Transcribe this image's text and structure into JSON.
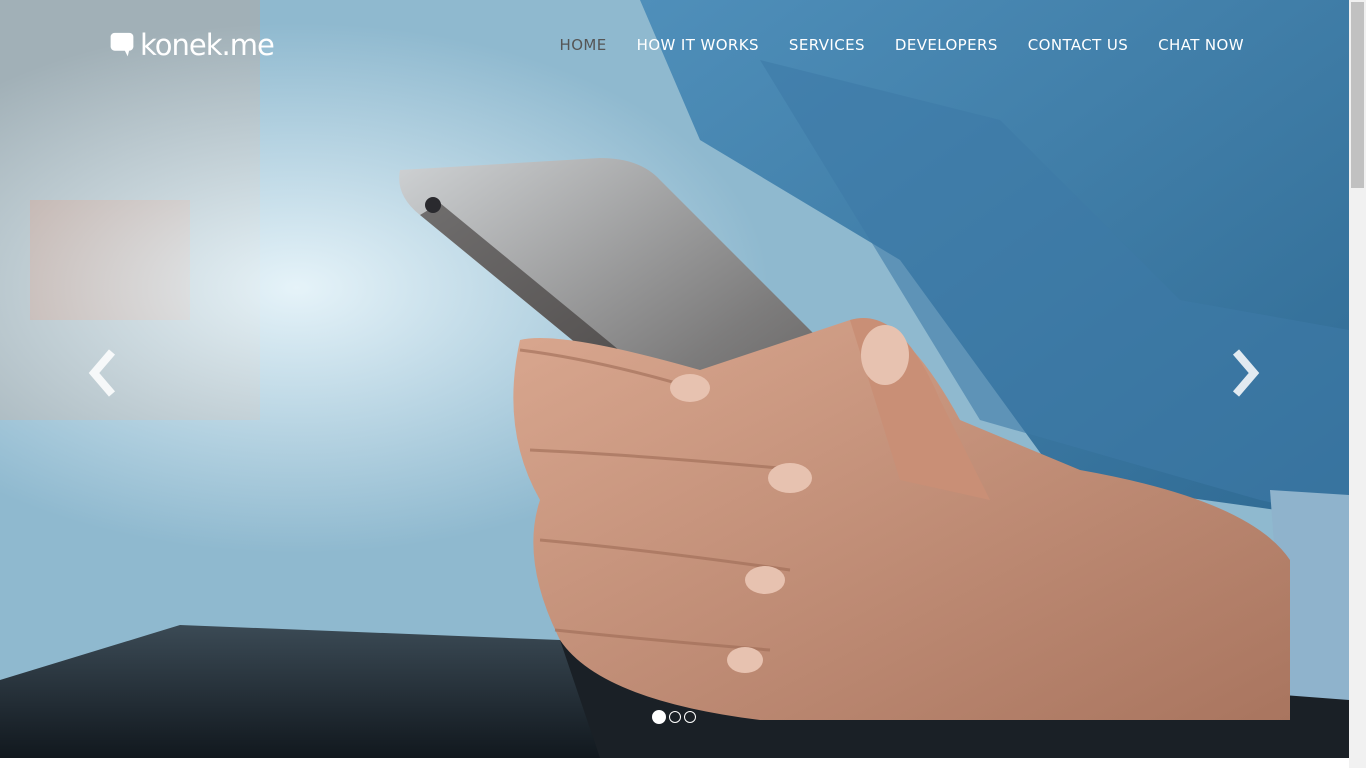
{
  "brand": {
    "name": "konek.me"
  },
  "nav": {
    "items": [
      {
        "label": "HOME",
        "active": true
      },
      {
        "label": "HOW IT WORKS",
        "active": false
      },
      {
        "label": "SERVICES",
        "active": false
      },
      {
        "label": "DEVELOPERS",
        "active": false
      },
      {
        "label": "CONTACT US",
        "active": false
      },
      {
        "label": "CHAT NOW",
        "active": false
      }
    ]
  },
  "carousel": {
    "slide_count": 3,
    "active_slide": 1,
    "prev_icon": "chevron-left-icon",
    "next_icon": "chevron-right-icon"
  },
  "colors": {
    "nav_text": "#ffffff",
    "nav_active": "#555555"
  }
}
